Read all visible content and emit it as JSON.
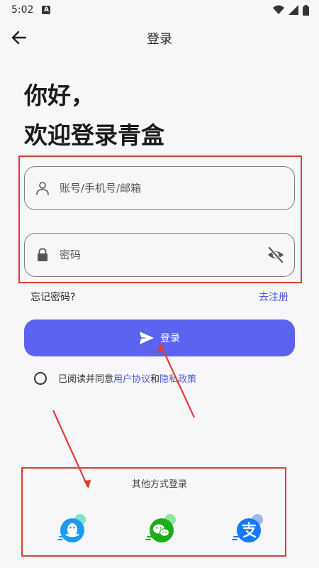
{
  "status_bar": {
    "time": "5:02",
    "notification_badge": "A"
  },
  "app_bar": {
    "title": "登录",
    "back_icon": "arrow-left-icon"
  },
  "greeting": {
    "line1": "你好，",
    "line2": "欢迎登录青盒"
  },
  "form": {
    "account_placeholder": "账号/手机号/邮箱",
    "account_value": "",
    "password_placeholder": "密码",
    "password_value": ""
  },
  "links": {
    "forgot": "忘记密码?",
    "register": "去注册"
  },
  "login_button": {
    "label": "登录"
  },
  "agreement": {
    "checked": false,
    "prefix": "已阅读并同意",
    "user_agreement": "用户协议",
    "and": "和",
    "privacy_policy": "隐私政策"
  },
  "other_login": {
    "title": "其他方式登录",
    "providers": [
      "qq-icon",
      "wechat-icon",
      "alipay-icon"
    ]
  },
  "colors": {
    "accent": "#5b63f0",
    "link": "#4a5ad9",
    "annotation": "#e53935",
    "qq": "#1e9af0",
    "wechat": "#1aad19",
    "alipay": "#1677ff"
  }
}
